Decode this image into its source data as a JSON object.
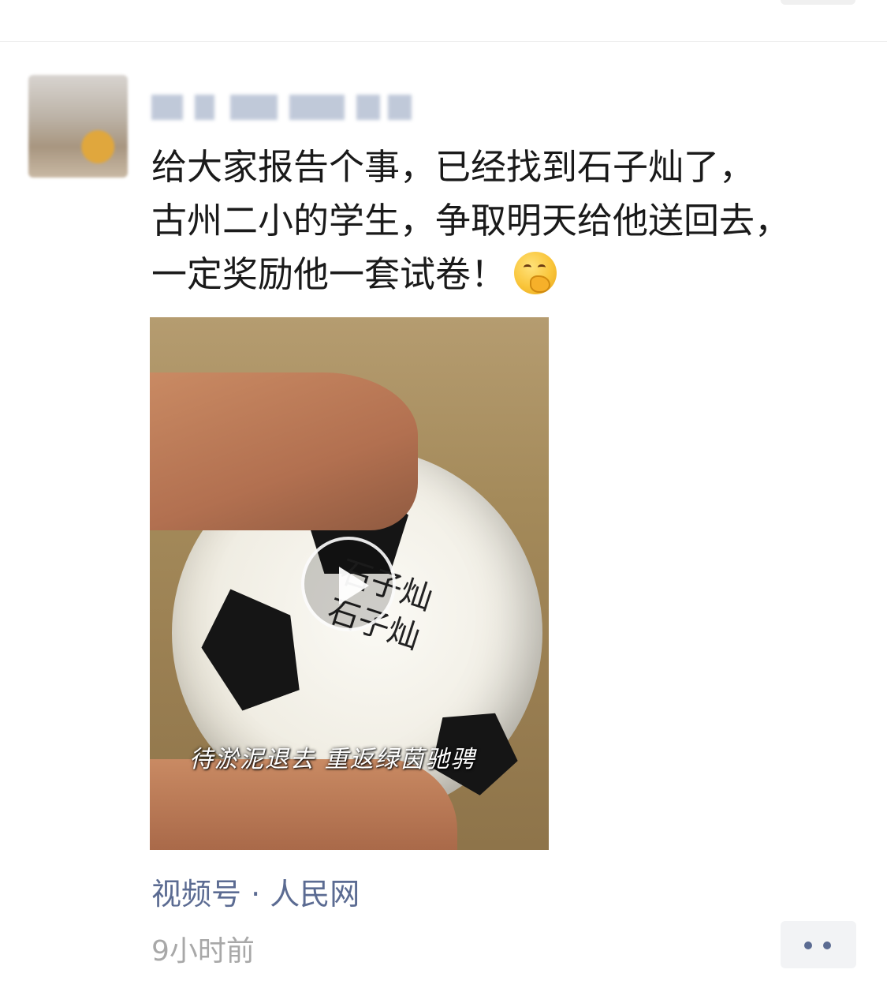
{
  "post": {
    "text_lines": [
      "给大家报告个事，已经找到石子灿了，",
      "古州二小的学生，争取明天给他送回去，",
      "一定奖励他一套试卷！"
    ],
    "emoji": "thinking-face-emoji",
    "video": {
      "ball_writing": [
        "石子灿",
        "石子灿"
      ],
      "caption": "待淤泥退去 重返绿茵驰骋"
    },
    "source": "视频号 · 人民网",
    "time": "9小时前"
  },
  "colors": {
    "link": "#5b6b92",
    "time": "#a8a8a8",
    "text": "#1a1a1a"
  }
}
